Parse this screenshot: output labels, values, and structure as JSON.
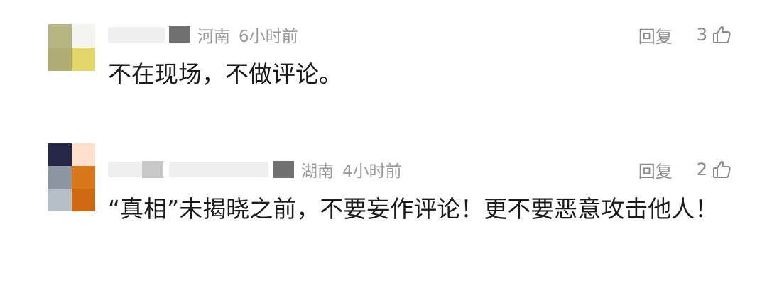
{
  "comments": [
    {
      "location": "河南",
      "time": "6小时前",
      "reply_label": "回复",
      "likes": "3",
      "text": "不在现场，不做评论。",
      "avatar_colors": [
        "#b4b581",
        "#f6f4f0",
        "#aeae74",
        "#e2d56a"
      ]
    },
    {
      "location": "湖南",
      "time": "4小时前",
      "reply_label": "回复",
      "likes": "2",
      "text": "“真相”未揭晓之前，不要妄作评论！更不要恶意攻击他人！",
      "avatar_colors": [
        "#262848",
        "#fde1cd",
        "#8c96a2",
        "#d8761a",
        "#b6bec8",
        "#cf6a12"
      ]
    }
  ]
}
